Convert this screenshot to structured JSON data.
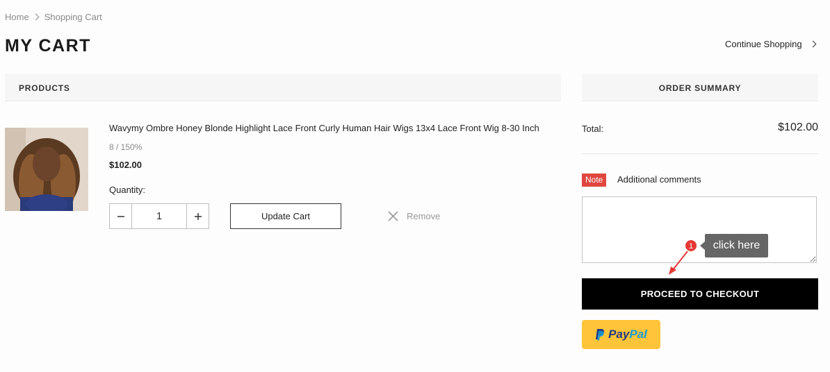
{
  "breadcrumb": {
    "home": "Home",
    "current": "Shopping Cart"
  },
  "page": {
    "title": "MY CART",
    "continue_shopping": "Continue Shopping"
  },
  "products": {
    "header": "PRODUCTS",
    "item": {
      "name": "Wavymy Ombre Honey Blonde Highlight Lace Front Curly Human Hair Wigs 13x4 Lace Front Wig 8-30 Inch",
      "variant": "8 / 150%",
      "price": "$102.00",
      "quantity_label": "Quantity:",
      "quantity": "1",
      "update_label": "Update Cart",
      "remove_label": "Remove"
    }
  },
  "summary": {
    "header": "ORDER SUMMARY",
    "total_label": "Total:",
    "total_value": "$102.00",
    "note_badge": "Note",
    "note_label": "Additional comments",
    "comments_value": "",
    "checkout_label": "PROCEED TO CHECKOUT",
    "paypal": {
      "pay": "Pay",
      "pal": "Pal"
    }
  },
  "annotation": {
    "step": "1",
    "text": "click here"
  },
  "colors": {
    "checkout_bg": "#000000",
    "paypal_bg": "#ffc439",
    "note_badge": "#e0473f",
    "annotation_badge": "#e53935"
  }
}
